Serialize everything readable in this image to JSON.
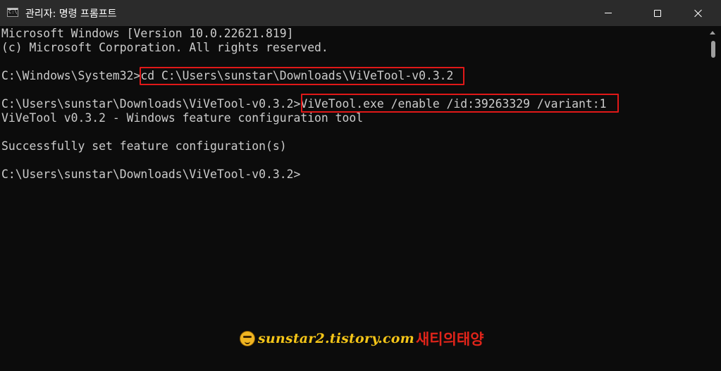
{
  "window": {
    "title": "관리자: 명령 프롬프트",
    "app_icon_text": "C:\\_"
  },
  "console": {
    "lines": [
      "Microsoft Windows [Version 10.0.22621.819]",
      "(c) Microsoft Corporation. All rights reserved.",
      "",
      "C:\\Windows\\System32>cd C:\\Users\\sunstar\\Downloads\\ViVeTool-v0.3.2",
      "",
      "C:\\Users\\sunstar\\Downloads\\ViVeTool-v0.3.2>ViVeTool.exe /enable /id:39263329 /variant:1",
      "ViVeTool v0.3.2 - Windows feature configuration tool",
      "",
      "Successfully set feature configuration(s)",
      "",
      "C:\\Users\\sunstar\\Downloads\\ViVeTool-v0.3.2>"
    ],
    "text_color": "#cccccc",
    "background": "#0c0c0c",
    "highlight_color": "#e01818"
  },
  "watermark": {
    "site": "sunstar2.tistory.com",
    "korean": "새티의태양"
  },
  "icons": {
    "minimize": "minimize-icon",
    "maximize": "maximize-icon",
    "close": "close-icon",
    "app": "cmd-icon"
  }
}
